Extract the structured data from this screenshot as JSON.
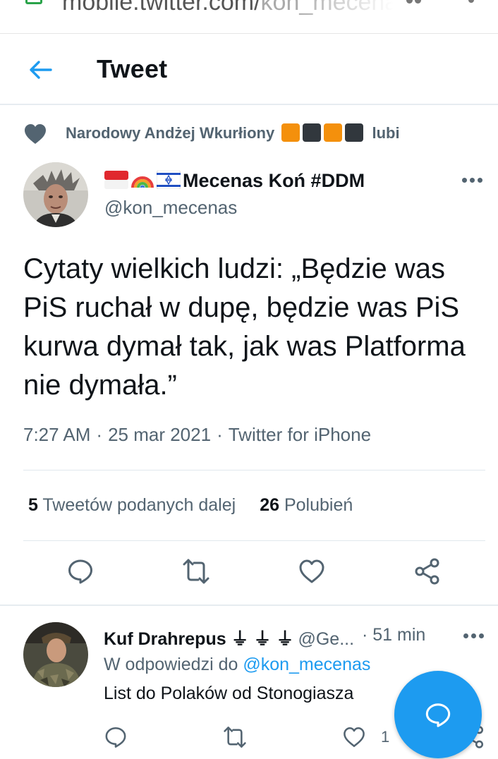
{
  "browser": {
    "url_visible": "mobile.twitter.com/",
    "url_faded": "kon_mecenas"
  },
  "header": {
    "back_icon": "arrow-left-icon",
    "title": "Tweet"
  },
  "social_context": {
    "icon": "heart-icon",
    "name": "Narodowy Andżej Wkurłiony",
    "squares": [
      "orange",
      "dark",
      "orange",
      "dark"
    ],
    "suffix": "lubi"
  },
  "tweet": {
    "author_name": "Mecenas Koń #DDM",
    "author_flags": [
      "indonesia-flag",
      "rainbow",
      "israel-flag"
    ],
    "author_handle": "@kon_mecenas",
    "text": "Cytaty wielkich ludzi: „Będzie was PiS ruchał w dupę, będzie was PiS kurwa dymał tak, jak was Platforma nie dymała.”",
    "time": "7:27 AM",
    "date": "25 mar 2021",
    "client": "Twitter for iPhone",
    "retweets_count": "5",
    "retweets_label": "Tweetów podanych dalej",
    "likes_count": "26",
    "likes_label": "Polubień"
  },
  "reply": {
    "author_name": "Kuf Drahrepus ⏚ ⏚ ⏚",
    "author_handle": "@Ge...",
    "time": "51 min",
    "reply_prefix": "W odpowiedzi do",
    "reply_target": "@kon_mecenas",
    "text": "List do Polaków od Stonogiasza",
    "likes_count": "1"
  },
  "colors": {
    "accent": "#1d9bf0",
    "secondary_text": "#536471",
    "divider": "#e6ecf0"
  }
}
